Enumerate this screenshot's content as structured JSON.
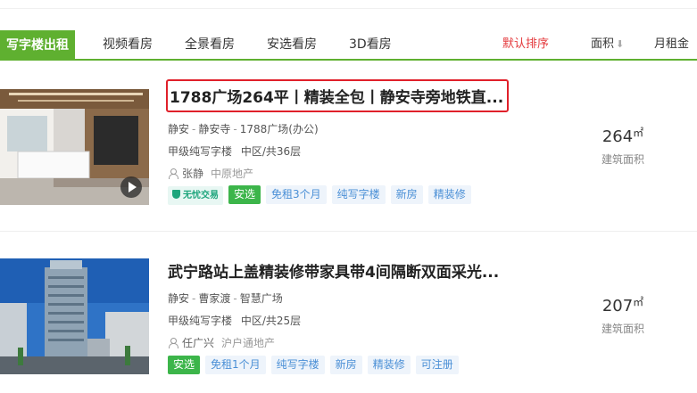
{
  "tabs": [
    {
      "label": "写字楼出租",
      "active": true
    },
    {
      "label": "视频看房"
    },
    {
      "label": "全景看房"
    },
    {
      "label": "安选看房"
    },
    {
      "label": "3D看房"
    }
  ],
  "sort": {
    "default_label": "默认排序",
    "area_label": "面积",
    "area_arrow": "⬇",
    "rent_label": "月租金"
  },
  "listings": [
    {
      "title": "1788广场264平丨精装全包丨静安寺旁地铁直...",
      "district": "静安",
      "area_name": "静安寺",
      "building": "1788广场(办公)",
      "grade": "甲级纯写字楼",
      "floor": "中区/共36层",
      "agent": "张静",
      "company": "中原地产",
      "has_video": true,
      "safe_badge": "无忧交易",
      "tags": [
        "安选",
        "免租3个月",
        "纯写字楼",
        "新房",
        "精装修"
      ],
      "area_value": "264",
      "area_unit": "㎡",
      "area_label": "建筑面积"
    },
    {
      "title": "武宁路站上盖精装修带家具带4间隔断双面采光...",
      "district": "静安",
      "area_name": "曹家渡",
      "building": "智慧广场",
      "grade": "甲级纯写字楼",
      "floor": "中区/共25层",
      "agent": "任广兴",
      "company": "沪户通地产",
      "has_video": false,
      "tags": [
        "安选",
        "免租1个月",
        "纯写字楼",
        "新房",
        "精装修",
        "可注册"
      ],
      "area_value": "207",
      "area_unit": "㎡",
      "area_label": "建筑面积"
    }
  ],
  "colors": {
    "accent_green": "#5fb030",
    "sort_active": "#e4393c",
    "tag_blue": "#4a8fd6",
    "tag_green": "#3cb54a",
    "highlight_border": "#e0202a"
  }
}
